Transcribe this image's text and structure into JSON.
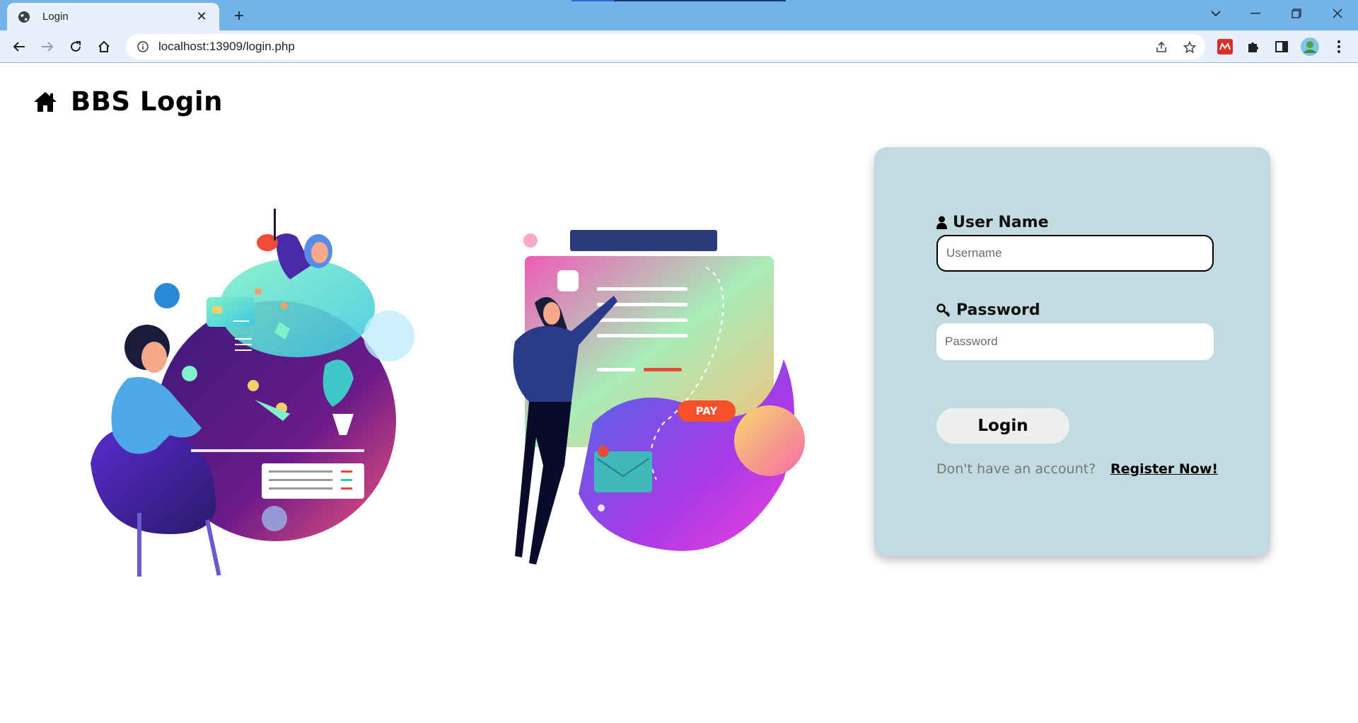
{
  "browser": {
    "tab_title": "Login",
    "url": "localhost:13909/login.php"
  },
  "page": {
    "heading": "BBS Login"
  },
  "form": {
    "username_label": "User Name",
    "username_placeholder": "Username",
    "password_label": "Password",
    "password_placeholder": "Password",
    "login_button": "Login",
    "no_account_text": "Don't have an account?",
    "register_link": "Register Now!"
  },
  "illustration": {
    "pay_badge": "PAY"
  },
  "colors": {
    "chrome_tabbar": "#74b2ea",
    "chrome_toolbar": "#e8f1fb",
    "card_background": "#c2dbe0"
  }
}
